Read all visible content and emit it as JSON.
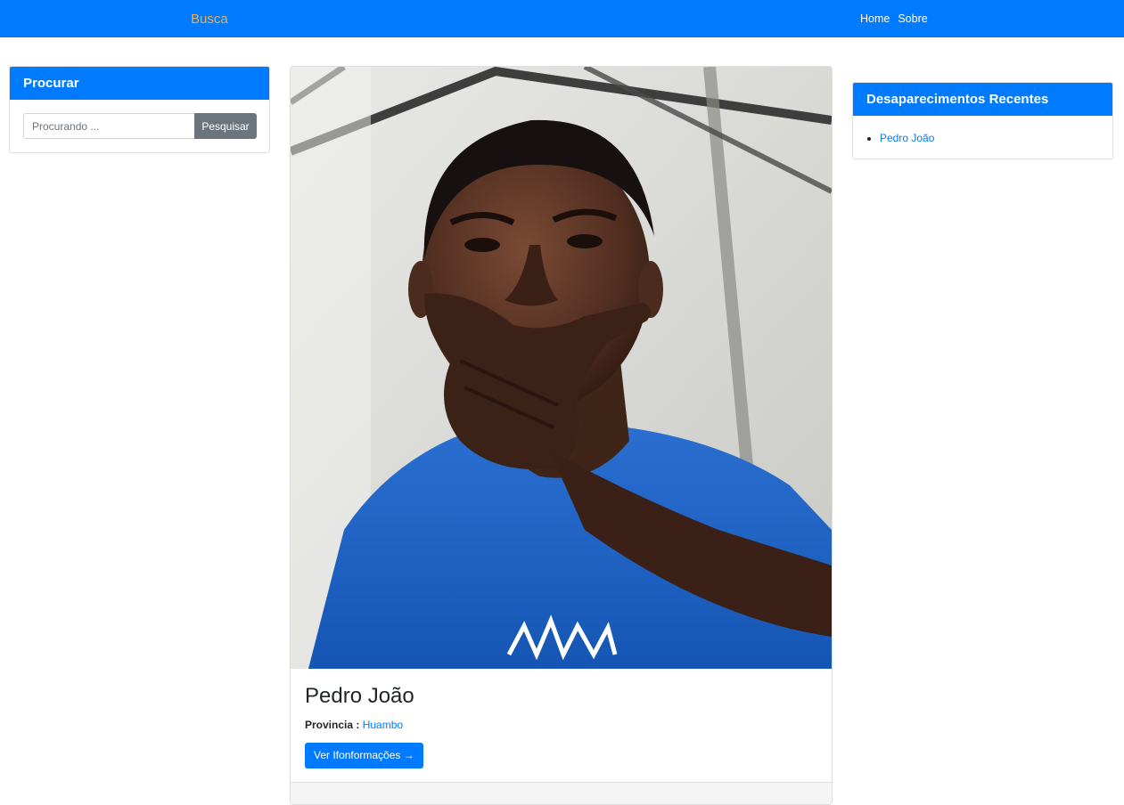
{
  "navbar": {
    "brand": "Busca",
    "links": [
      "Home",
      "Sobre"
    ]
  },
  "search": {
    "title": "Procurar",
    "placeholder": "Procurando ...",
    "button_label": "Pesquisar"
  },
  "post": {
    "title": "Pedro João",
    "province_label": "Provincia :",
    "province_value": "Huambo",
    "button_label": "Ver Ifonformações →"
  },
  "recent": {
    "title": "Desaparecimentos Recentes",
    "items": [
      "Pedro João"
    ]
  },
  "colors": {
    "primary": "#007bff",
    "brand": "#f0ad4e",
    "secondary_button": "#6c757d"
  }
}
